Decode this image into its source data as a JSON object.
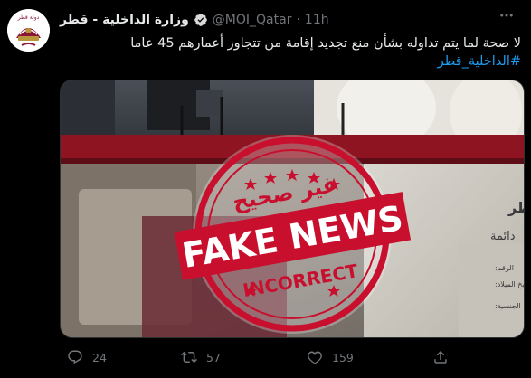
{
  "author": {
    "display_name": "وزارة الداخلية - قطر",
    "handle": "@MOI_Qatar",
    "separator": "·",
    "time": "11h",
    "verified": true
  },
  "tweet": {
    "text": "لا صحة لما يتم تداوله بشأن منع تجديد إقامة من تتجاوز أعمارهم 45 عاما",
    "hashtag": "#الداخلية_قطر"
  },
  "media": {
    "stamp_top": "غير صحيح",
    "stamp_main": "FAKE NEWS",
    "stamp_bottom": "INCORRECT",
    "card_qatar": "قطر",
    "card_permanent": "دائمة",
    "card_labels": [
      "الرقم:",
      "تاريخ الميلاد:",
      "الجنسية:"
    ]
  },
  "actions": {
    "reply_count": "24",
    "retweet_count": "57",
    "like_count": "159"
  },
  "colors": {
    "background": "#000000",
    "accent": "#1d9bf0",
    "muted": "#71767b",
    "stamp_red": "#c8102e",
    "qatar_maroon": "#8a1538"
  }
}
